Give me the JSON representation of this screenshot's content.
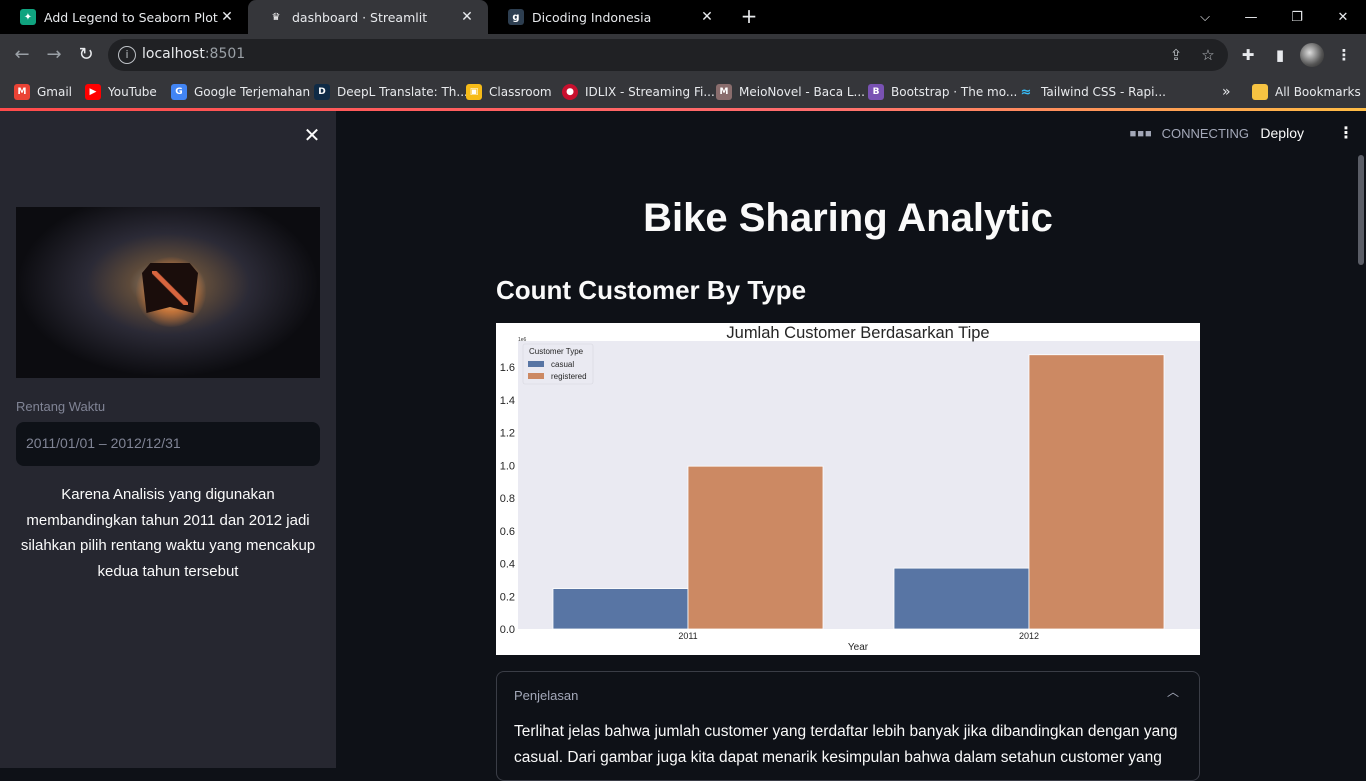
{
  "browser": {
    "tabs": [
      {
        "title": "Add Legend to Seaborn Plot",
        "icon": "chatgpt-icon",
        "active": false
      },
      {
        "title": "dashboard · Streamlit",
        "icon": "streamlit-icon",
        "active": true
      },
      {
        "title": "Dicoding Indonesia",
        "icon": "dicoding-icon",
        "active": false
      }
    ],
    "url_host": "localhost",
    "url_port": ":8501",
    "bookmarks": [
      {
        "label": "Gmail",
        "icon": "gmail-icon",
        "color": "#ea4335"
      },
      {
        "label": "YouTube",
        "icon": "youtube-icon",
        "color": "#ff0000"
      },
      {
        "label": "Google Terjemahan",
        "icon": "google-translate-icon",
        "color": "#4285f4"
      },
      {
        "label": "DeepL Translate: Th...",
        "icon": "deepl-icon",
        "color": "#0f2b46"
      },
      {
        "label": "Classroom",
        "icon": "classroom-icon",
        "color": "#f6bb18"
      },
      {
        "label": "IDLIX - Streaming Fi...",
        "icon": "idlix-icon",
        "color": "#c8102e"
      },
      {
        "label": "MeioNovel - Baca L...",
        "icon": "meionovel-icon",
        "color": "#8a6d6d"
      },
      {
        "label": "Bootstrap · The mo...",
        "icon": "bootstrap-icon",
        "color": "#7952b3"
      },
      {
        "label": "Tailwind CSS - Rapi...",
        "icon": "tailwind-icon",
        "color": "#38bdf8"
      }
    ],
    "all_bookmarks": "All Bookmarks"
  },
  "sidebar": {
    "image_alt": "dota-logo-image",
    "date_label": "Rentang Waktu",
    "date_value": "2011/01/01 – 2012/12/31",
    "note": "Karena Analisis yang digunakan membandingkan tahun 2011 dan 2012 jadi silahkan pilih rentang waktu yang mencakup kedua tahun tersebut"
  },
  "header": {
    "status": "CONNECTING",
    "deploy": "Deploy"
  },
  "main": {
    "title": "Bike Sharing Analytic",
    "section_title": "Count Customer By Type",
    "expander": {
      "label": "Penjelasan",
      "body": "Terlihat jelas bahwa jumlah customer yang terdaftar lebih banyak jika dibandingkan dengan yang casual. Dari gambar juga kita dapat menarik kesimpulan bahwa dalam setahun customer yang"
    }
  },
  "chart_data": {
    "type": "bar",
    "title": "Jumlah Customer Berdasarkan Tipe",
    "xlabel": "Year",
    "ylabel": "",
    "scale_label": "1e6",
    "categories": [
      "2011",
      "2012"
    ],
    "series": [
      {
        "name": "casual",
        "color": "#5875a4",
        "values": [
          0.247,
          0.372
        ]
      },
      {
        "name": "registered",
        "color": "#cc8963",
        "values": [
          0.995,
          1.676
        ]
      }
    ],
    "legend_title": "Customer Type",
    "legend_position": "top-left",
    "yticks": [
      "0.0",
      "0.2",
      "0.4",
      "0.6",
      "0.8",
      "1.0",
      "1.2",
      "1.4",
      "1.6"
    ],
    "ylim": [
      0,
      1.76
    ],
    "background": "#eaeaf2"
  }
}
